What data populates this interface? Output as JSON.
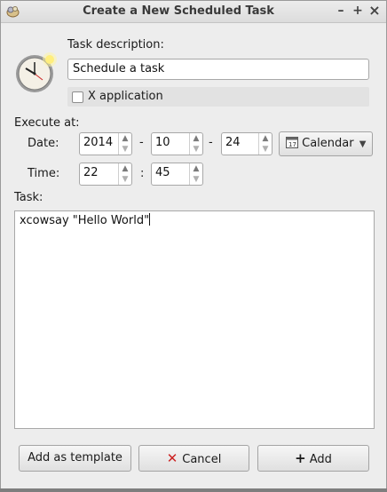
{
  "window": {
    "title": "Create a New Scheduled Task",
    "controls": {
      "minimize": "–",
      "maximize": "+",
      "close": "×"
    }
  },
  "task_description": {
    "label": "Task description:",
    "value": "Schedule a task"
  },
  "x_application": {
    "label": "X application",
    "checked": false
  },
  "execute_at": {
    "label": "Execute at:",
    "date_label": "Date:",
    "year": "2014",
    "month": "10",
    "day": "24",
    "date_separator": "-",
    "calendar_button": "Calendar",
    "time_label": "Time:",
    "hour": "22",
    "minute": "45",
    "time_separator": ":"
  },
  "task": {
    "label": "Task:",
    "command": "xcowsay \"Hello World\""
  },
  "buttons": {
    "add_template": "Add as template",
    "cancel": "Cancel",
    "add": "Add"
  },
  "colors": {
    "cancel_icon": "#cc2222",
    "clock_face": "#f4f0e6",
    "clock_rim": "#a8a8a8"
  }
}
